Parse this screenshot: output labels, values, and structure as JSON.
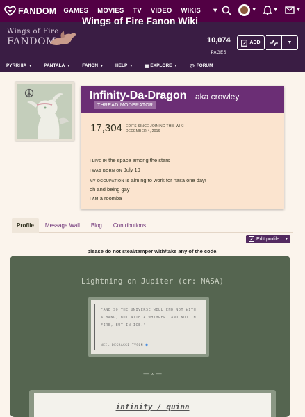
{
  "topbar": {
    "logo_text": "FANDOM",
    "nav": [
      "GAMES",
      "MOVIES",
      "TV",
      "VIDEO",
      "WIKIS"
    ]
  },
  "wiki": {
    "logo_line1": "Wings of Fire",
    "logo_line2": "FANDOM",
    "title": "Wings of Fire Fanon Wiki",
    "page_count": "10,074",
    "pages_label": "PAGES",
    "add_label": "ADD"
  },
  "subnav": [
    "PYRRHIA",
    "PANTALA",
    "FANON",
    "HELP",
    "EXPLORE",
    "FORUM"
  ],
  "profile": {
    "username": "Infinity-Da-Dragon",
    "aka": "aka crowley",
    "tag": "THREAD MODERATOR",
    "edits": "17,304",
    "edits_label_1": "EDITS SINCE JOINING THIS WIKI",
    "edits_label_2": "DECEMBER 4, 2016",
    "live_label": "I LIVE IN",
    "live_value": "the space among the stars",
    "born_label": "I WAS BORN ON",
    "born_value": "July 19",
    "occ_label": "MY OCCUPATION IS",
    "occ_value": "aiming to work for nasa one day! oh and being gay",
    "am_label": "I AM",
    "am_value": "a roomba"
  },
  "tabs": [
    "Profile",
    "Message Wall",
    "Blog",
    "Contributions"
  ],
  "edit_profile": "Edit profile",
  "notice": "please do not steal/tamper with/take any of the code.",
  "panel": {
    "title": "Lightning on Jupiter (cr: NASA)",
    "quote": "\"AND SO THE UNIVERSE WILL END NOT WITH A BANG, BUT WITH A WHIMPER. AND NOT IN FIRE, BUT IN ICE.\"",
    "cite": "NEIL DEGRASSE TYSON",
    "separator": "— ∞ —",
    "bottom_title": "infinity / quinn"
  },
  "colors": {
    "topbar": "#520044",
    "header": "#3a1d44",
    "name_bar": "#6b2e75",
    "panel": "#556550"
  }
}
